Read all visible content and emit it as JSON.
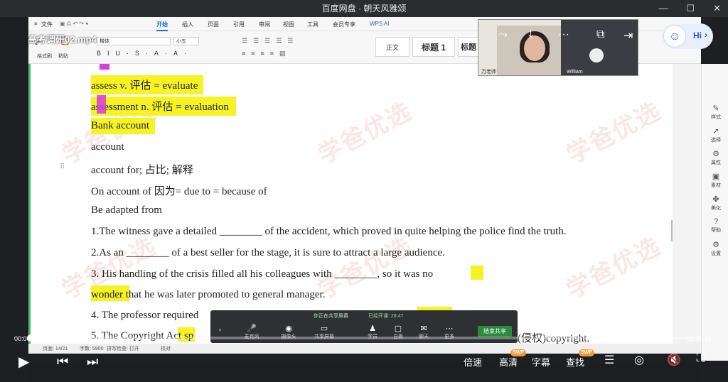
{
  "window": {
    "title": "百度网盘 · 朝天风雅颂"
  },
  "video": {
    "filename": "高考调研02.mp4",
    "elapsed": "00:00:10",
    "total": "01:05:15",
    "progress": 0.003
  },
  "wps": {
    "menu": [
      "文件",
      "开始",
      "插入",
      "页面",
      "引用",
      "审阅",
      "视图",
      "工具",
      "会员专享",
      "WPS AI"
    ],
    "active_tab": "开始",
    "font_name": "楷体",
    "font_size": "小五",
    "format_painter": "格式刷",
    "paste": "粘贴",
    "styles": [
      "正文",
      "标题 1",
      "标题"
    ],
    "status": [
      "页面: 14/21",
      "字数: 5900",
      "拼写检查: 打开",
      "校对"
    ]
  },
  "document": {
    "lines": [
      {
        "text": "assess v.  评估  = evaluate",
        "highlight": true
      },
      {
        "text": "assessment n.  评估  = evaluation",
        "highlight": true
      },
      {
        "text": "Bank account",
        "highlight": true
      },
      {
        "text": "account",
        "highlight": false
      },
      {
        "text": "account for;  占比;  解释",
        "highlight": false
      },
      {
        "text": "On account of  因为= due to = because of",
        "highlight": false
      },
      {
        "text": "Be adapted from",
        "highlight": false
      },
      {
        "text": "1.The witness gave a detailed ________ of the accident, which proved in quite helping the police find the truth.",
        "highlight": false
      },
      {
        "text": "2.As an ________ of a best seller for the stage, it is sure to attract a large audience.",
        "highlight": false
      },
      {
        "text": "3. His handling of the crisis filled all his colleagues with ________, so it was no",
        "highlight": false
      },
      {
        "text": "wonder that he was later promoted to general manager.",
        "highlight": false
      },
      {
        "text": "4. The professor required",
        "highlight": false
      },
      {
        "text": "5. The Copyright Act sp",
        "highlight": false
      }
    ],
    "trailing_text": "(侵权)copyright."
  },
  "sidepanel": [
    "样式",
    "选择",
    "属性",
    "素材",
    "美化",
    "帮助",
    "设置"
  ],
  "call": {
    "teacher_label": "万老师",
    "participant": "William"
  },
  "share_toolbar": {
    "status": "你正在共享屏幕",
    "started": "已经开课: 28:47",
    "buttons": [
      "麦克风",
      "摄像头",
      "共享屏幕",
      "学员",
      "白板",
      "聊天",
      "更多"
    ],
    "end": "结束共享"
  },
  "assistant": {
    "label": "Hi"
  },
  "player": {
    "speed": "倍速",
    "quality": "高清",
    "subtitles": "字幕",
    "search": "查找",
    "badge": "SWP"
  },
  "colors": {
    "highlight": "#f7f224",
    "magenta": "#d63be0",
    "accent": "#4aa3ff"
  }
}
